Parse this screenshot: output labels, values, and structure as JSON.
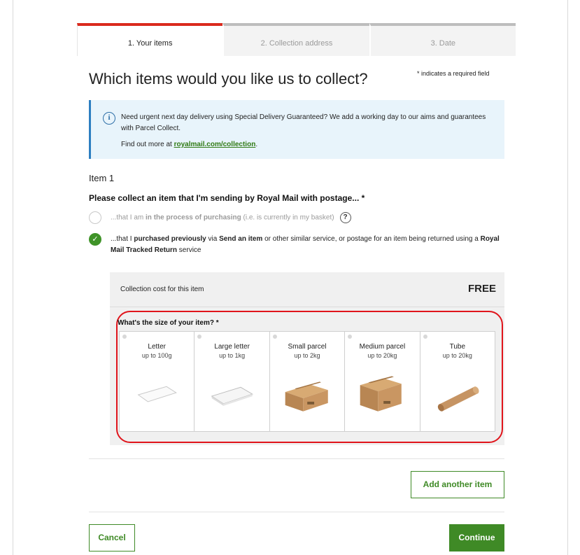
{
  "steps": [
    {
      "label": "1. Your items",
      "active": true
    },
    {
      "label": "2. Collection address",
      "active": false
    },
    {
      "label": "3. Date",
      "active": false
    }
  ],
  "page_title": "Which items would you like us to collect?",
  "required_note": "* indicates a required field",
  "info": {
    "icon": "info-icon",
    "text": "Need urgent next day delivery using Special Delivery Guaranteed? We add a working day to our aims and guarantees with Parcel Collect.",
    "more_prefix": "Find out more at ",
    "more_link": "royalmail.com/collection",
    "more_suffix": "."
  },
  "item_label": "Item 1",
  "question": "Please collect an item that I'm sending by Royal Mail with postage... *",
  "options": [
    {
      "selected": false,
      "text_pre": "...that I am ",
      "text_bold": "in the process of purchasing",
      "text_post": " (i.e. is currently in my basket)",
      "help_icon": "?"
    },
    {
      "selected": true,
      "text_pre": "...that I ",
      "text_bold": "purchased previously",
      "text_mid": " via ",
      "text_bold2": "Send an item",
      "text_mid2": " or other similar service, or postage for an item being returned using a ",
      "text_bold3": "Royal Mail Tracked Return",
      "text_post": " service"
    }
  ],
  "cost": {
    "label": "Collection cost for this item",
    "value": "FREE"
  },
  "size_question": "What's the size of your item? *",
  "sizes": [
    {
      "name": "Letter",
      "limit": "up to 100g",
      "icon": "letter-icon"
    },
    {
      "name": "Large letter",
      "limit": "up to 1kg",
      "icon": "large-letter-icon"
    },
    {
      "name": "Small parcel",
      "limit": "up to 2kg",
      "icon": "small-parcel-icon"
    },
    {
      "name": "Medium parcel",
      "limit": "up to 20kg",
      "icon": "medium-parcel-icon"
    },
    {
      "name": "Tube",
      "limit": "up to 20kg",
      "icon": "tube-icon"
    }
  ],
  "buttons": {
    "add": "Add another item",
    "cancel": "Cancel",
    "continue": "Continue"
  },
  "colors": {
    "accent_red": "#da2a1d",
    "green": "#3f8a26",
    "info_bg": "#e8f4fb",
    "highlight": "#e0141b"
  }
}
